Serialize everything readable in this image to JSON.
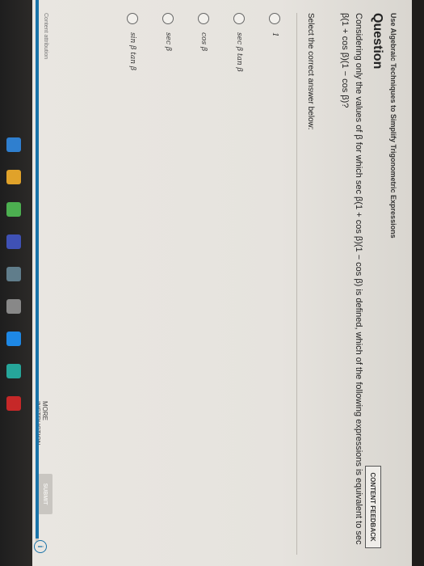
{
  "topic": "Use Algebraic Techniques to Simplify Trigonometric Expressions",
  "feedback_label": "CONTENT FEEDBACK",
  "question_heading": "Question",
  "prompt": "Considering only the values of β for which sec β(1 + cos β)(1 − cos β) is defined, which of the following expressions is equivalent to sec β(1 + cos β)(1 − cos β)?",
  "select_label": "Select the correct answer below:",
  "options": [
    "1",
    "sec β tan β",
    "cos β",
    "sec β",
    "sin β tan β"
  ],
  "more_instruction": "MORE INSTRUCTION",
  "submit_label": "SUBMIT",
  "attribution": "Content attribution",
  "progress": 0.98,
  "colors": {
    "accent": "#1a73a8",
    "background": "#e9e6e1"
  }
}
